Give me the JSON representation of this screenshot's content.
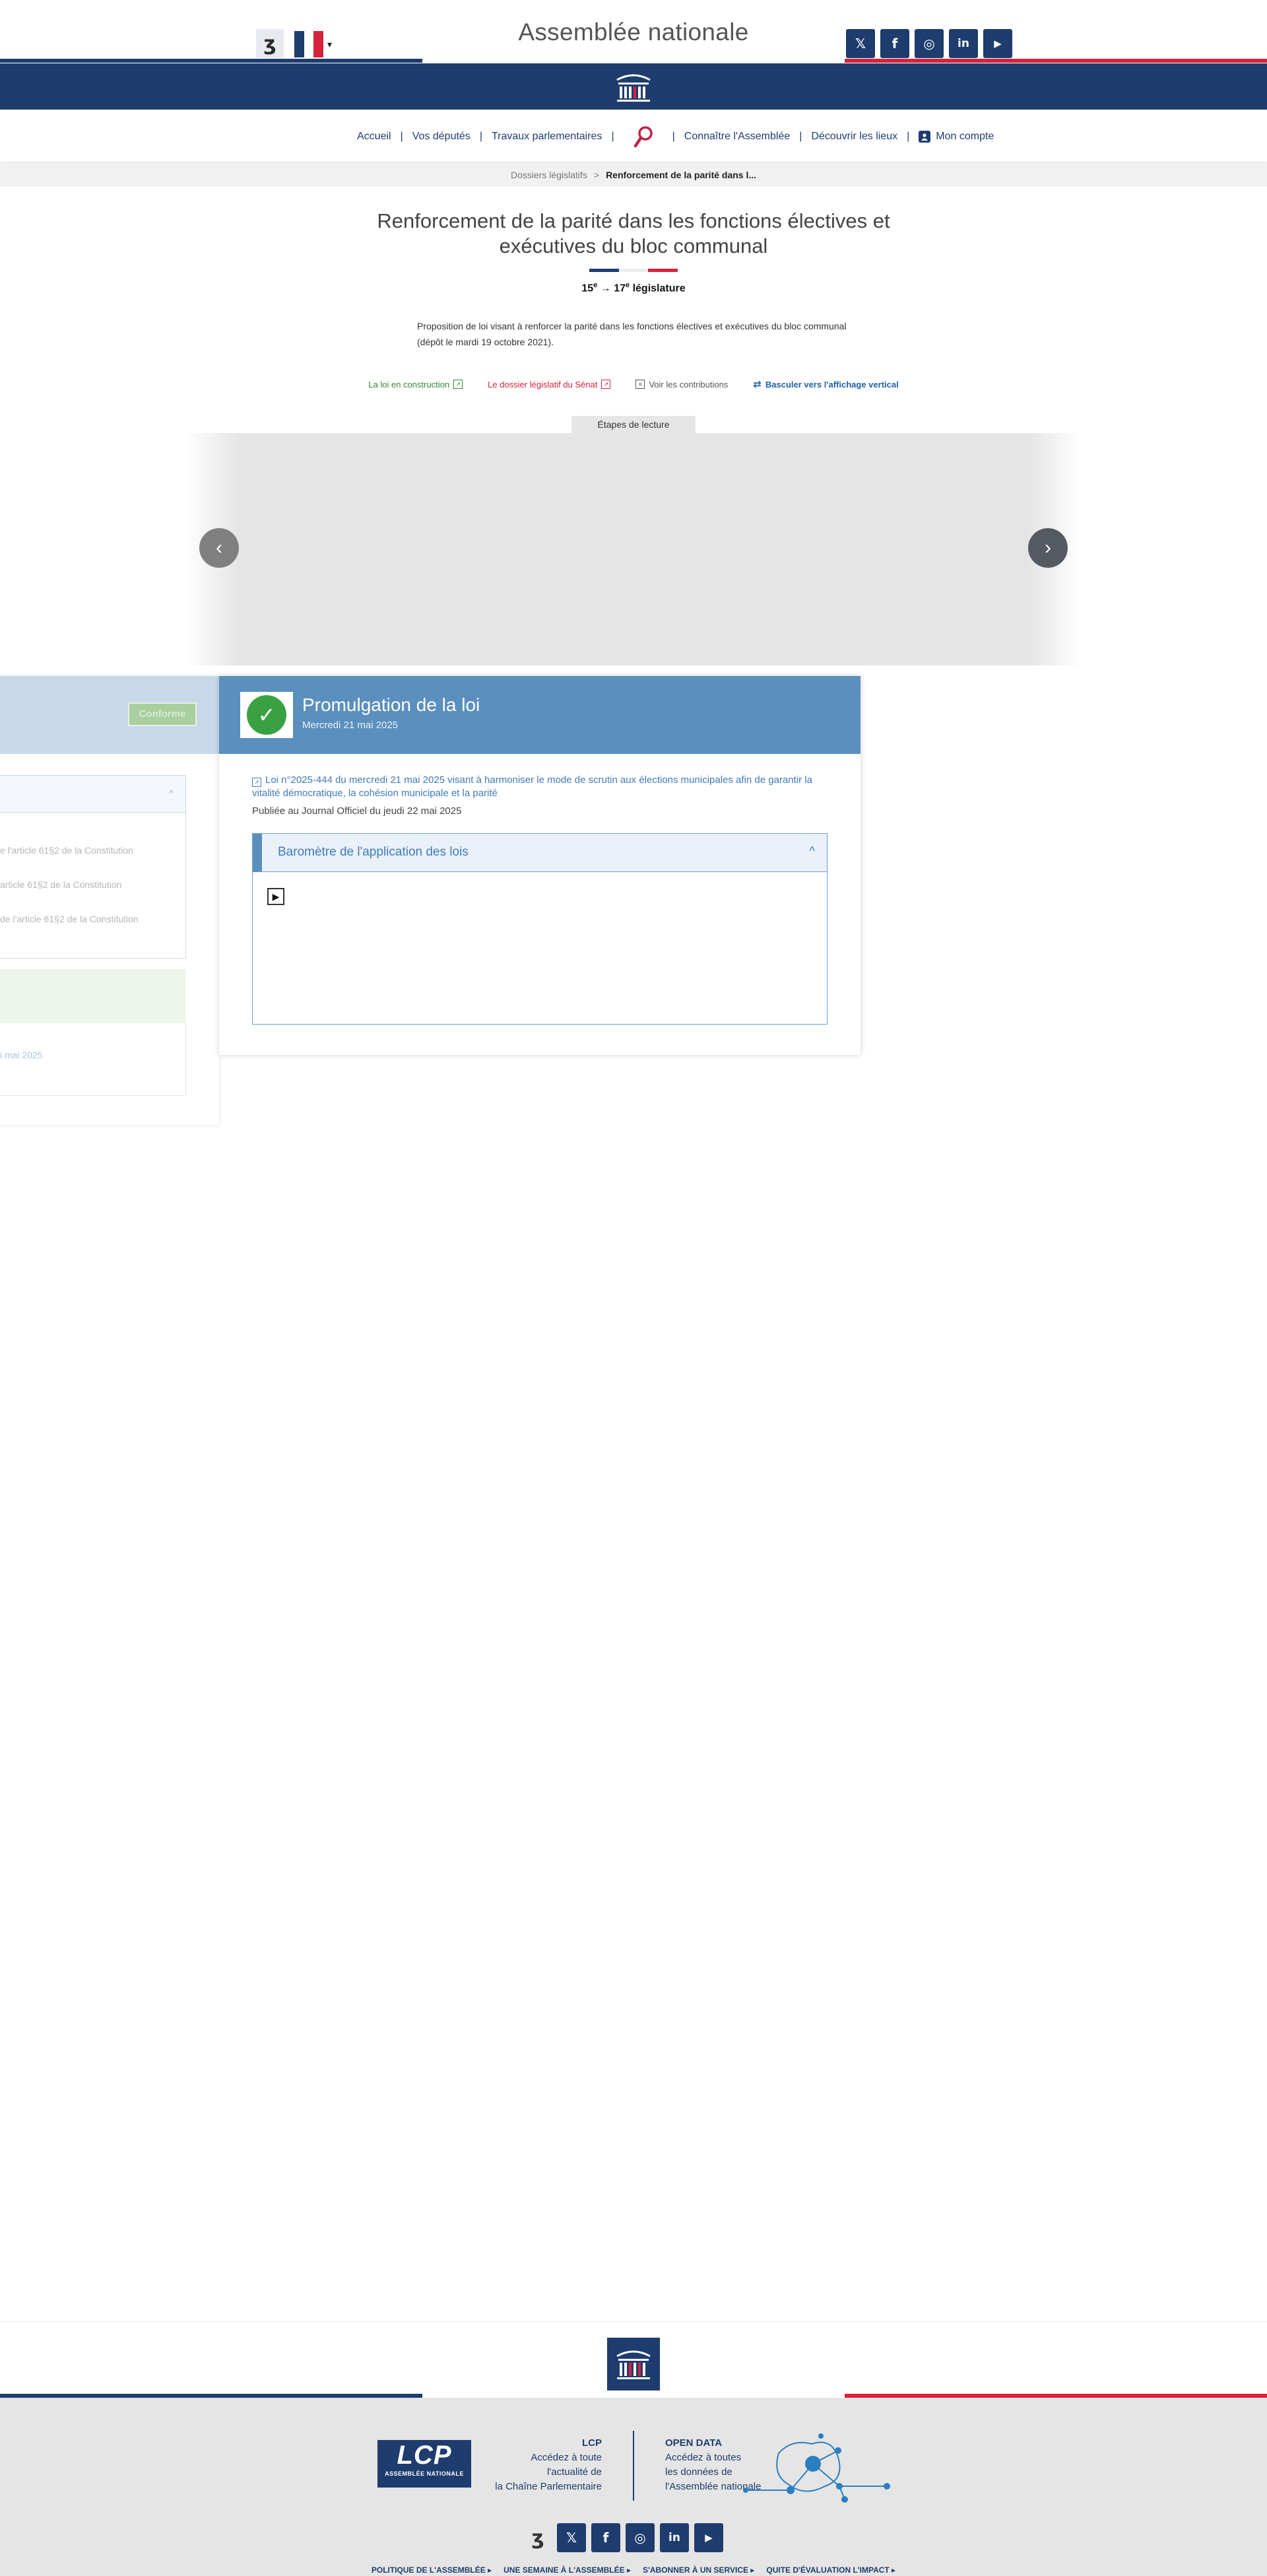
{
  "header": {
    "site_title": "Assemblée nationale",
    "ear_label": "ʒ",
    "language_chevron": "▾",
    "flag_colors": [
      "#1e3c6e",
      "#ffffff",
      "#d7223b"
    ],
    "socials": [
      {
        "icon": "x-icon",
        "glyph": "𝕏"
      },
      {
        "icon": "facebook-icon",
        "glyph": "f"
      },
      {
        "icon": "instagram-icon",
        "glyph": "◎"
      },
      {
        "icon": "linkedin-icon",
        "glyph": "in"
      },
      {
        "icon": "youtube-icon",
        "glyph": "▶"
      }
    ]
  },
  "nav": {
    "items": [
      "Accueil",
      "Vos députés",
      "Travaux parlementaires",
      "Connaître l'Assemblée",
      "Découvrir les lieux"
    ],
    "account": "Mon compte"
  },
  "breadcrumb": {
    "parent": "Dossiers législatifs",
    "separator": ">",
    "current": "Renforcement de la parité dans l..."
  },
  "dossier": {
    "title": "Renforcement de la parité dans les fonctions électives et exécutives du bloc communal",
    "legislature_start": "15",
    "legislature_end": "17",
    "legislature_sup": "e",
    "legislature_arrow": "→",
    "legislature_label": "législature",
    "description": "Proposition de loi visant à renforcer la parité dans les fonctions électives et exécutives du bloc communal (dépôt le mardi 19 octobre 2021)."
  },
  "links": {
    "loi_construction": "La loi en construction",
    "senat": "Le dossier législatif du Sénat",
    "contributions": "Voir les contributions",
    "vertical": "Basculer vers l'affichage vertical"
  },
  "etapes_label": "Étapes de lecture",
  "carousel": {
    "prev_glyph": "‹",
    "next_glyph": "›"
  },
  "ghost_card": {
    "badge": "Conforme",
    "lines": [
      "e l'article 61§2 de la Constitution",
      "article 61§2 de la Constitution",
      "de l'article 61§2 de la Constitution"
    ],
    "date": "i mai 2025"
  },
  "card": {
    "check_glyph": "✓",
    "title": "Promulgation de la loi",
    "date": "Mercredi 21 mai 2025",
    "loi_link": "Loi n°2025-444 du mercredi 21 mai 2025 visant à harmoniser le mode de scrutin aux élections municipales afin de garantir la vitalité démocratique, la cohésion municipale et la parité",
    "publication": "Publiée au Journal Officiel du jeudi 22 mai 2025",
    "barometre_title": "Baromètre de l'application des lois",
    "barometre_chev": "^",
    "play_glyph": "▶"
  },
  "footer": {
    "lcp_logo_main": "LCP",
    "lcp_logo_sub": "ASSEMBLÉE NATIONALE",
    "lcp_title": "LCP",
    "lcp_line1": "Accédez à toute",
    "lcp_line2": "l'actualité de",
    "lcp_line3": "la Chaîne Parlementaire",
    "od_title": "OPEN DATA",
    "od_line1": "Accédez à toutes",
    "od_line2": "les données de",
    "od_line3": "l'Assemblée nationale",
    "links": [
      "POLITIQUE DE L'ASSEMBLÉE ▸",
      "UNE SEMAINE À L'ASSEMBLÉE ▸",
      "S'ABONNER À UN SERVICE ▸",
      "QUITE D'ÉVALUATION L'IMPACT ▸"
    ]
  },
  "colors": {
    "navy": "#1e3c6e",
    "red": "#d7223b",
    "card_blue": "#5b8fbd",
    "green": "#3aa142"
  }
}
